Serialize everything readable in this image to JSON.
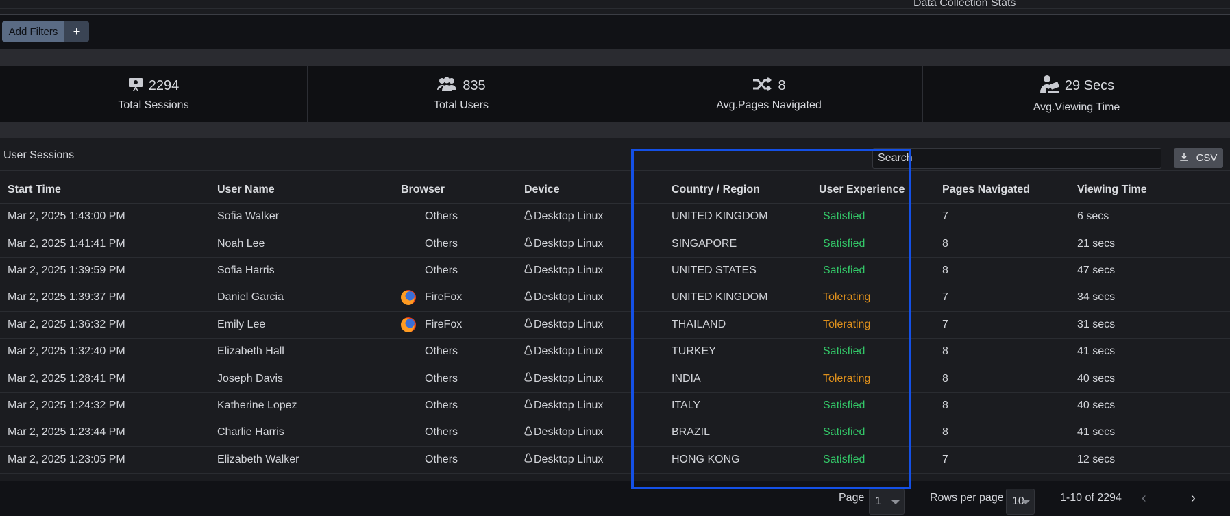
{
  "header": {
    "section_label": "Data Collection Stats"
  },
  "filters": {
    "add_label": "Add Filters",
    "add_icon": "plus-icon"
  },
  "stats": [
    {
      "icon": "presentation-icon",
      "value": "2294",
      "caption": "Total Sessions"
    },
    {
      "icon": "users-icon",
      "value": "835",
      "caption": "Total Users"
    },
    {
      "icon": "shuffle-icon",
      "value": "8",
      "caption": "Avg.Pages Navigated"
    },
    {
      "icon": "viewer-icon",
      "value": "29 Secs",
      "caption": "Avg.Viewing Time"
    }
  ],
  "sessions": {
    "title": "User Sessions",
    "search_placeholder": "Search",
    "csv_label": "CSV",
    "columns": [
      "Start Time",
      "User Name",
      "Browser",
      "Device",
      "Country / Region",
      "User Experience",
      "Pages Navigated",
      "Viewing Time"
    ],
    "rows": [
      {
        "time": "Mar 2, 2025 1:43:00 PM",
        "user": "Sofia Walker",
        "browser": "Others",
        "browser_icon": "",
        "device": "Desktop Linux",
        "country": "UNITED KINGDOM",
        "ux": "Satisfied",
        "pages": "7",
        "view": "6 secs"
      },
      {
        "time": "Mar 2, 2025 1:41:41 PM",
        "user": "Noah Lee",
        "browser": "Others",
        "browser_icon": "",
        "device": "Desktop Linux",
        "country": "SINGAPORE",
        "ux": "Satisfied",
        "pages": "8",
        "view": "21 secs"
      },
      {
        "time": "Mar 2, 2025 1:39:59 PM",
        "user": "Sofia Harris",
        "browser": "Others",
        "browser_icon": "",
        "device": "Desktop Linux",
        "country": "UNITED STATES",
        "ux": "Satisfied",
        "pages": "8",
        "view": "47 secs"
      },
      {
        "time": "Mar 2, 2025 1:39:37 PM",
        "user": "Daniel Garcia",
        "browser": "FireFox",
        "browser_icon": "firefox-icon",
        "device": "Desktop Linux",
        "country": "UNITED KINGDOM",
        "ux": "Tolerating",
        "pages": "7",
        "view": "34 secs"
      },
      {
        "time": "Mar 2, 2025 1:36:32 PM",
        "user": "Emily Lee",
        "browser": "FireFox",
        "browser_icon": "firefox-icon",
        "device": "Desktop Linux",
        "country": "THAILAND",
        "ux": "Tolerating",
        "pages": "7",
        "view": "31 secs"
      },
      {
        "time": "Mar 2, 2025 1:32:40 PM",
        "user": "Elizabeth Hall",
        "browser": "Others",
        "browser_icon": "",
        "device": "Desktop Linux",
        "country": "TURKEY",
        "ux": "Satisfied",
        "pages": "8",
        "view": "41 secs"
      },
      {
        "time": "Mar 2, 2025 1:28:41 PM",
        "user": "Joseph Davis",
        "browser": "Others",
        "browser_icon": "",
        "device": "Desktop Linux",
        "country": "INDIA",
        "ux": "Tolerating",
        "pages": "8",
        "view": "40 secs"
      },
      {
        "time": "Mar 2, 2025 1:24:32 PM",
        "user": "Katherine Lopez",
        "browser": "Others",
        "browser_icon": "",
        "device": "Desktop Linux",
        "country": "ITALY",
        "ux": "Satisfied",
        "pages": "8",
        "view": "40 secs"
      },
      {
        "time": "Mar 2, 2025 1:23:44 PM",
        "user": "Charlie Harris",
        "browser": "Others",
        "browser_icon": "",
        "device": "Desktop Linux",
        "country": "BRAZIL",
        "ux": "Satisfied",
        "pages": "8",
        "view": "41 secs"
      },
      {
        "time": "Mar 2, 2025 1:23:05 PM",
        "user": "Elizabeth Walker",
        "browser": "Others",
        "browser_icon": "",
        "device": "Desktop Linux",
        "country": "HONG KONG",
        "ux": "Satisfied",
        "pages": "7",
        "view": "12 secs"
      }
    ]
  },
  "pagination": {
    "page_label": "Page",
    "page_value": "1",
    "rows_label": "Rows per page",
    "rows_value": "10",
    "range": "1-10 of 2294"
  },
  "colors": {
    "satisfied": "#33c768",
    "tolerating": "#e0911c",
    "highlight": "#1450e6"
  }
}
